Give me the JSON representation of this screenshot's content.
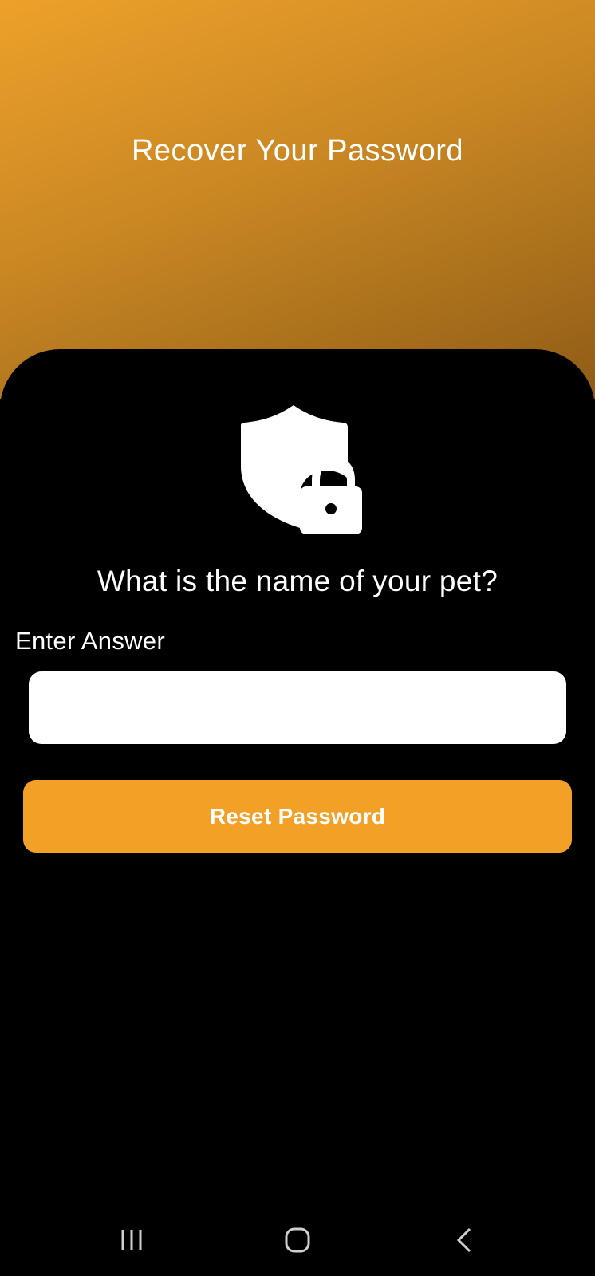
{
  "header": {
    "title": "Recover Your Password",
    "gradient_colors": [
      "#eea12a",
      "#8f5c16"
    ]
  },
  "security": {
    "icon": "shield-lock-icon",
    "question": "What is the name of your pet?"
  },
  "answer": {
    "label": "Enter Answer",
    "value": "",
    "placeholder": ""
  },
  "actions": {
    "reset_label": "Reset Password",
    "accent_color": "#f2a026"
  },
  "navbar": {
    "recent_icon": "recent-apps-icon",
    "home_icon": "home-icon",
    "back_icon": "back-icon"
  }
}
